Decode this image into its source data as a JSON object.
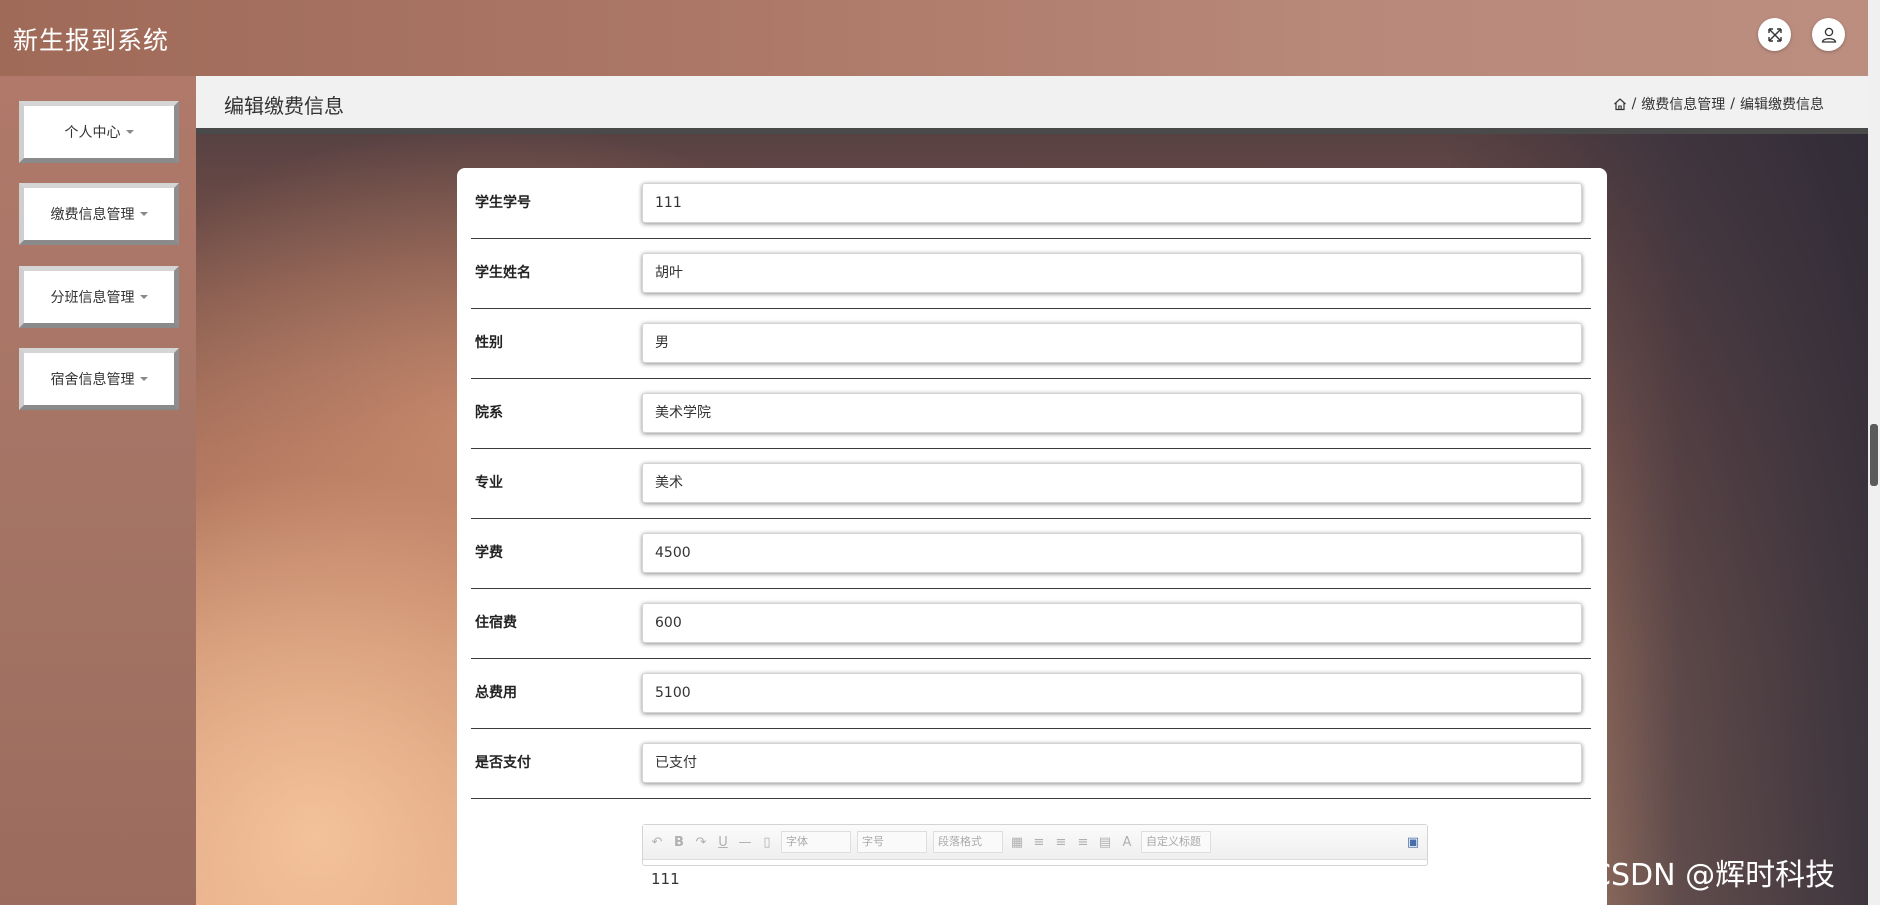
{
  "app": {
    "title": "新生报到系统"
  },
  "header": {
    "fullscreen_icon": "expand-arrows-icon",
    "user_icon": "user-icon"
  },
  "sidebar": {
    "items": [
      {
        "label": "个人中心"
      },
      {
        "label": "缴费信息管理"
      },
      {
        "label": "分班信息管理"
      },
      {
        "label": "宿舍信息管理"
      }
    ]
  },
  "page": {
    "title": "编辑缴费信息",
    "breadcrumb": [
      "缴费信息管理",
      "编辑缴费信息"
    ]
  },
  "form": {
    "fields": [
      {
        "label": "学生学号",
        "value": "111"
      },
      {
        "label": "学生姓名",
        "value": "胡叶"
      },
      {
        "label": "性别",
        "value": "男"
      },
      {
        "label": "院系",
        "value": "美术学院"
      },
      {
        "label": "专业",
        "value": "美术"
      },
      {
        "label": "学费",
        "value": "4500"
      },
      {
        "label": "住宿费",
        "value": "600"
      },
      {
        "label": "总费用",
        "value": "5100"
      },
      {
        "label": "是否支付",
        "value": "已支付"
      }
    ],
    "editor": {
      "font_label": "字体",
      "size_label": "字号",
      "paragraph_label": "段落格式",
      "custom_title_label": "自定义标题",
      "content": "111"
    }
  },
  "watermark": "CSDN @辉时科技"
}
